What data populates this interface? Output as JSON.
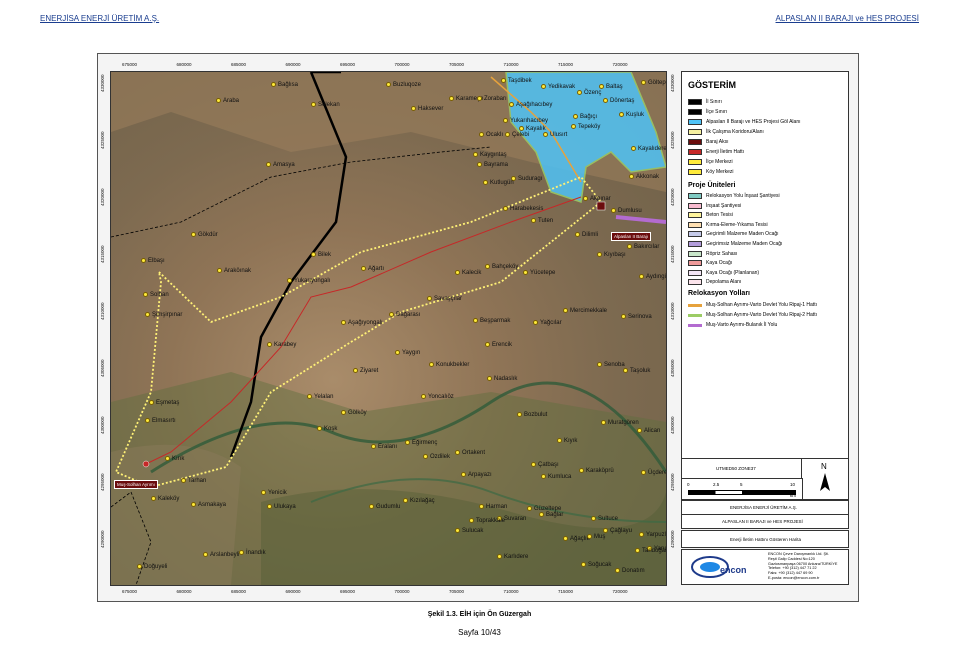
{
  "header": {
    "left": "ENERJİSA ENERJİ ÜRETİM A.Ş.",
    "right": "ALPASLAN II BARAJI ve HES PROJESİ"
  },
  "map": {
    "x_ticks": [
      "675000",
      "680000",
      "685000",
      "690000",
      "695000",
      "700000",
      "705000",
      "710000",
      "715000",
      "720000"
    ],
    "y_ticks": [
      "4330000",
      "4325000",
      "4320000",
      "4315000",
      "4310000",
      "4305000",
      "4300000",
      "4295000",
      "4290000"
    ],
    "places": [
      {
        "name": "Bağlısa"
      },
      {
        "name": "Buzluqoze"
      },
      {
        "name": "Taşdibek"
      },
      {
        "name": "Yedikavak"
      },
      {
        "name": "Baltaş"
      },
      {
        "name": "Göltepe"
      },
      {
        "name": "Araba"
      },
      {
        "name": "Selekan"
      },
      {
        "name": "Haksever"
      },
      {
        "name": "Karameşe"
      },
      {
        "name": "Zorabarı"
      },
      {
        "name": "Aşağıhacıbey"
      },
      {
        "name": "Özenç"
      },
      {
        "name": "Dönertaş"
      },
      {
        "name": "Bağıçı"
      },
      {
        "name": "Kuşluk"
      },
      {
        "name": "Yukarıhacıbey"
      },
      {
        "name": "Kayalık"
      },
      {
        "name": "Tepeköy"
      },
      {
        "name": "Ocaklı"
      },
      {
        "name": "Çelebi"
      },
      {
        "name": "Ulusırt"
      },
      {
        "name": "Kayalıdere"
      },
      {
        "name": "Kaygıntaş"
      },
      {
        "name": "Bayrama"
      },
      {
        "name": "Amasya"
      },
      {
        "name": "Suduragı"
      },
      {
        "name": "Akkonak"
      },
      {
        "name": "Kutlugün"
      },
      {
        "name": "Akpınar"
      },
      {
        "name": "Dumlusu"
      },
      {
        "name": "Harabekesis"
      },
      {
        "name": "Tuten"
      },
      {
        "name": "Dilimli"
      },
      {
        "name": "Gökdür"
      },
      {
        "name": "Bakırcılar"
      },
      {
        "name": "Elbaşı"
      },
      {
        "name": "Bilek"
      },
      {
        "name": "Ağartı"
      },
      {
        "name": "Kıyıbaşı"
      },
      {
        "name": "Araköınak"
      },
      {
        "name": "Bahçeköy"
      },
      {
        "name": "Yücetepe"
      },
      {
        "name": "Yukarıyongalı"
      },
      {
        "name": "Kalecik"
      },
      {
        "name": "Aydıngün"
      },
      {
        "name": "Solhan"
      },
      {
        "name": "Savaşçılar"
      },
      {
        "name": "Şimşirpınar"
      },
      {
        "name": "Dağarası"
      },
      {
        "name": "Beşparmak"
      },
      {
        "name": "Yağcılar"
      },
      {
        "name": "Mercimekkale"
      },
      {
        "name": "Serinova"
      },
      {
        "name": "Aşağıyongalı"
      },
      {
        "name": "Karabey"
      },
      {
        "name": "Erencik"
      },
      {
        "name": "Yaygın"
      },
      {
        "name": "Konukbekler"
      },
      {
        "name": "Senoba"
      },
      {
        "name": "Taşoluk"
      },
      {
        "name": "Ziyaret"
      },
      {
        "name": "Nadaslık"
      },
      {
        "name": "Eşmetaş"
      },
      {
        "name": "Yelalan"
      },
      {
        "name": "Yoncalıöz"
      },
      {
        "name": "Elmasırtı"
      },
      {
        "name": "Gölköy"
      },
      {
        "name": "Bozbulut"
      },
      {
        "name": "Muratgören"
      },
      {
        "name": "Alican"
      },
      {
        "name": "Koşk"
      },
      {
        "name": "Eralanı"
      },
      {
        "name": "Eğirmenç"
      },
      {
        "name": "Kıyık"
      },
      {
        "name": "Ozdilek"
      },
      {
        "name": "Ortakent"
      },
      {
        "name": "Kırık"
      },
      {
        "name": "Çatbaşı"
      },
      {
        "name": "Karaköprü"
      },
      {
        "name": "Üçdere"
      },
      {
        "name": "Tarhan"
      },
      {
        "name": "Arpayazı"
      },
      {
        "name": "Kumluca"
      },
      {
        "name": "Kaleköy"
      },
      {
        "name": "Yenicik"
      },
      {
        "name": "Kızılağaç"
      },
      {
        "name": "Harman"
      },
      {
        "name": "Güzeltepe"
      },
      {
        "name": "Asmakaya"
      },
      {
        "name": "Ulukaya"
      },
      {
        "name": "Gudumlu"
      },
      {
        "name": "Suvaran"
      },
      {
        "name": "Bağlar"
      },
      {
        "name": "Toprakkale"
      },
      {
        "name": "Sultuce"
      },
      {
        "name": "Çağlayu"
      },
      {
        "name": "Yarpuzlu"
      },
      {
        "name": "Sulucak"
      },
      {
        "name": "Ağaçlık"
      },
      {
        "name": "Muş"
      },
      {
        "name": "Yarıcı"
      },
      {
        "name": "Tandoğan"
      },
      {
        "name": "Arslanbeyli"
      },
      {
        "name": "İnandık"
      },
      {
        "name": "Karlıdere"
      },
      {
        "name": "Soğucak"
      },
      {
        "name": "Doğuyeli"
      },
      {
        "name": "Donatım"
      }
    ],
    "callouts": [
      {
        "text": "Muş-Solhan Ayrımı"
      },
      {
        "text": "Alpaslan II Barajı"
      }
    ]
  },
  "legend": {
    "title": "GÖSTERİM",
    "items": [
      {
        "label": "İl Sınırı",
        "color": "#000000"
      },
      {
        "label": "İlçe Sınırı",
        "color": "#000000"
      },
      {
        "label": "Alpaslan II Barajı ve HES Projesi Göl Alanı",
        "color": "#4fc3f7"
      },
      {
        "label": "İlk Çalışma Koridoru/Alanı",
        "color": "#f5f0a0"
      },
      {
        "label": "Baraj Aksı",
        "color": "#6b0d0d"
      },
      {
        "label": "Enerji İletim Hattı",
        "color": "#c62828"
      },
      {
        "label": "İlçe Merkezi",
        "color": "#ffeb3b"
      },
      {
        "label": "Köy Merkezi",
        "color": "#ffeb3b"
      }
    ],
    "section_units": "Proje Üniteleri",
    "units": [
      {
        "label": "Relokasyon Yolu İnşaat Şantiyesi",
        "color": "#80cbc4"
      },
      {
        "label": "İnşaat Şantiyesi",
        "color": "#f8bbd0"
      },
      {
        "label": "Beton Tesisi",
        "color": "#fff59d"
      },
      {
        "label": "Kırma-Eleme-Yıkama Tesisi",
        "color": "#ffe0b2"
      },
      {
        "label": "Geçirimli Malzeme Maden Ocağı",
        "color": "#c5cae9"
      },
      {
        "label": "Geçirimsiz Malzeme Maden Ocağı",
        "color": "#b39ddb"
      },
      {
        "label": "Röpriz Sahası",
        "color": "#c8e6c9"
      },
      {
        "label": "Kaya Ocağı",
        "color": "#ef9a9a"
      },
      {
        "label": "Kaya Ocağı (Planlanan)",
        "color": "#f3e5f5"
      },
      {
        "label": "Depolama Alanı",
        "color": "#fce4ec"
      }
    ],
    "section_roads": "Relokasyon Yolları",
    "roads": [
      {
        "label": "Muş-Solhan Ayrımı-Varto Devlet Yolu Ripaj-1 Hattı",
        "color": "#e6a23c"
      },
      {
        "label": "Muş-Solhan Ayrımı-Varto Devlet Yolu Ripaj-2 Hattı",
        "color": "#9ccc65"
      },
      {
        "label": "Muş-Varto Ayrımı-Bulanık İl Yolu",
        "color": "#b36bd0"
      }
    ]
  },
  "info": {
    "projection": "UTMED50 ZONE37",
    "north": "N",
    "scale_ticks": [
      "0",
      "2.5",
      "5",
      "10"
    ],
    "scale_unit": "km",
    "company": "ENERJİSA ENERJİ ÜRETİM A.Ş.",
    "project": "ALPASLAN II BARAJI ve HES PROJESİ",
    "map_title": "Enerji İletim Hattını Gösteren Harita",
    "consultant": "ENCON Çevre Danışmanlık Ltd. Şti.",
    "addr1": "Reşit Galip Caddesi No:120",
    "addr2": "Gaziosmanpaşa 06700 Ankara/TÜRKİYE",
    "tel": "Telefon: +90 (312) 447 71 22",
    "fax": "Faks:    +90 (312) 447 69 90",
    "email": "E-posta: encon@encon.com.tr",
    "logo": "encon"
  },
  "footer": {
    "caption": "Şekil 1.3. EİH için Ön Güzergah",
    "page": "Sayfa 10/43"
  }
}
